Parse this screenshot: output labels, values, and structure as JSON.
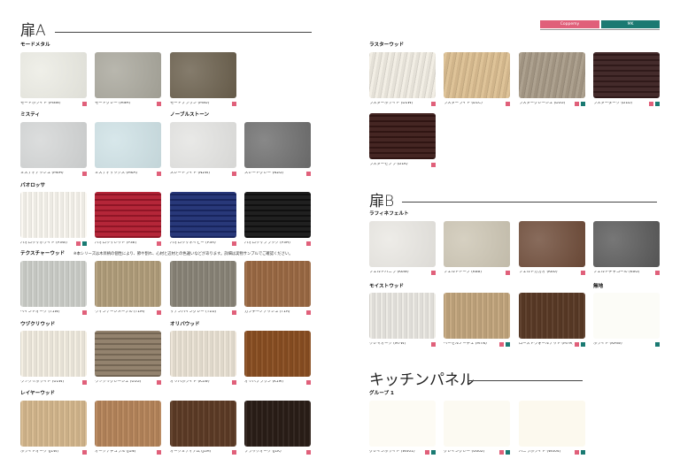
{
  "header": {
    "legend": [
      {
        "label": "Coppemy",
        "color": "#e0607a"
      },
      {
        "label": "MK",
        "color": "#1a7a72"
      }
    ]
  },
  "colors": {
    "pink": "#e0607a",
    "teal": "#1a7a72"
  },
  "left_page": {
    "title": "扉A",
    "groups": [
      {
        "name": "モードメタル",
        "items": [
          {
            "name": "モードホワイト (MSW)",
            "color": "#ecece4",
            "marks": [
              "pink"
            ]
          },
          {
            "name": "モードグレー (MSH)",
            "color": "#a9a79c",
            "marks": [
              "pink"
            ]
          },
          {
            "name": "モードブラウン (MSU)",
            "color": "#6a5f4c",
            "marks": [
              "pink"
            ]
          }
        ]
      },
      {
        "name": "ミスティ",
        "items": [
          {
            "name": "ミスティアッシュ (M6H)",
            "color": "#d4d6d6",
            "marks": [
              "pink"
            ]
          },
          {
            "name": "ミスティサックス (M6A)",
            "color": "#cfe2e6",
            "marks": [
              "pink"
            ]
          }
        ]
      },
      {
        "name": "ノーブルストーン",
        "items": [
          {
            "name": "スレートライト (N2W)",
            "color": "#e4e4e2",
            "marks": [
              "pink"
            ]
          },
          {
            "name": "スレートグレー (N2G)",
            "color": "#6e6e6e",
            "marks": [
              "pink"
            ]
          }
        ]
      },
      {
        "name": "パオロッサ",
        "items": [
          {
            "name": "パオロッサホワイト (P3W)",
            "color": "#fbf8f1",
            "marks": [
              "pink",
              "teal"
            ]
          },
          {
            "name": "パオロッサレッド (P3E)",
            "color": "#b01a2e",
            "marks": [
              "pink"
            ]
          },
          {
            "name": "パオロッサネイビー (P3A)",
            "color": "#1d2d72",
            "marks": [
              "pink"
            ]
          },
          {
            "name": "パオロッサブラック (P3H)",
            "color": "#141414",
            "marks": [
              "pink"
            ]
          }
        ]
      },
      {
        "name": "テクスチャーウッド",
        "note": "※本シリーズは木目柄の個性により、節や割れ、心材と辺材との色違いなどがあります。詳細は実物サンプルでご確認ください。",
        "items": [
          {
            "name": "ペイントオーク (T1W)",
            "color": "#cfd1cc",
            "marks": [
              "pink"
            ]
          },
          {
            "name": "ヴィンテージメープル (T1M)",
            "color": "#b39f7c",
            "marks": [
              "pink"
            ]
          },
          {
            "name": "サテンパイングレー (T1G)",
            "color": "#8b8679",
            "marks": [
              "pink"
            ]
          },
          {
            "name": "カフチーノアッシュ (T1A)",
            "color": "#9c6a44",
            "marks": [
              "pink"
            ]
          }
        ]
      },
      {
        "name": "ウヅクリウッド",
        "items": [
          {
            "name": "ウヅクリホワイト (U1W)",
            "color": "#f3eee2",
            "marks": [
              "pink"
            ]
          },
          {
            "name": "ウヅクリグレージュ (U1G)",
            "color": "#8d7c66",
            "marks": [
              "pink"
            ]
          }
        ]
      },
      {
        "name": "オリバウッド",
        "items": [
          {
            "name": "オリバホワイト (K1W)",
            "color": "#ece4d6",
            "marks": [
              "pink"
            ]
          },
          {
            "name": "オリバブラウン (K1M)",
            "color": "#8a4f22",
            "marks": [
              "pink"
            ]
          }
        ]
      },
      {
        "name": "レイヤーウッド",
        "items": [
          {
            "name": "ホワイトオーク (J1W)",
            "color": "#d6b98e",
            "marks": [
              "pink"
            ]
          },
          {
            "name": "オークナチュラル (J1N)",
            "color": "#b7865b",
            "marks": [
              "pink"
            ]
          },
          {
            "name": "オークミディアム (J1M)",
            "color": "#5e3c26",
            "marks": [
              "pink"
            ]
          },
          {
            "name": "ブラックオーク (J1K)",
            "color": "#2a1e17",
            "marks": [
              "pink"
            ]
          }
        ]
      }
    ]
  },
  "right_page": {
    "raster_title": "ラスターウッド",
    "raster_items": [
      {
        "name": "ラスターホワイト (D1W)",
        "color": "#f1ede3",
        "marks": [
          "pink"
        ]
      },
      {
        "name": "ラスターライト (D1C)",
        "color": "#dcbf92",
        "marks": [
          "pink"
        ]
      },
      {
        "name": "ラスターグレージュ (D1G)",
        "color": "#a89b88",
        "marks": [
          "pink",
          "teal"
        ]
      },
      {
        "name": "ラスターダーク (D1D)",
        "color": "#3a2020",
        "marks": [
          "pink",
          "teal"
        ]
      },
      {
        "name": "ラスターゼブラ (D1K)",
        "color": "#3b1a17",
        "marks": [
          "pink"
        ]
      }
    ],
    "title_b": "扉B",
    "groups_b": [
      {
        "name": "ラフィネフェルト",
        "items": [
          {
            "name": "フェルトバニラ (K6W)",
            "color": "#eae8e3",
            "marks": [
              "pink"
            ]
          },
          {
            "name": "フェルトトープ (K6B)",
            "color": "#cdc6b4",
            "marks": [
              "pink"
            ]
          },
          {
            "name": "フェルトカカオ (K6U)",
            "color": "#6e4b38",
            "marks": [
              "pink"
            ]
          },
          {
            "name": "フェルトチャコール (K6G)",
            "color": "#595959",
            "marks": [
              "pink"
            ]
          }
        ]
      },
      {
        "name": "モイストウッド",
        "items": [
          {
            "name": "クレマオーク (M7W)",
            "color": "#eceae4",
            "marks": [
              "pink"
            ]
          },
          {
            "name": "ヘーゼルノーチェ (M7N)",
            "color": "#c4a77e",
            "marks": [
              "pink",
              "teal"
            ]
          },
          {
            "name": "ローストウォールナット (M7M)",
            "color": "#5a3a26",
            "marks": [
              "pink",
              "teal"
            ]
          }
        ]
      },
      {
        "name": "無地",
        "items": [
          {
            "name": "ホワイト (KMW)",
            "color": "#fcfcf7",
            "marks": [
              "teal"
            ]
          }
        ]
      }
    ],
    "title_kitchen": "キッチンパネル",
    "kitchen_group": "グループ 1",
    "kitchen_items": [
      {
        "name": "グレインホワイト (W001)",
        "color": "#fdfbf4",
        "marks": [
          "pink",
          "teal"
        ]
      },
      {
        "name": "グレイングレー (G002)",
        "color": "#fcfaf2",
        "marks": [
          "pink",
          "teal"
        ]
      },
      {
        "name": "バニラホワイト (W004)",
        "color": "#fcf9ee",
        "marks": [
          "pink",
          "teal"
        ]
      }
    ]
  }
}
